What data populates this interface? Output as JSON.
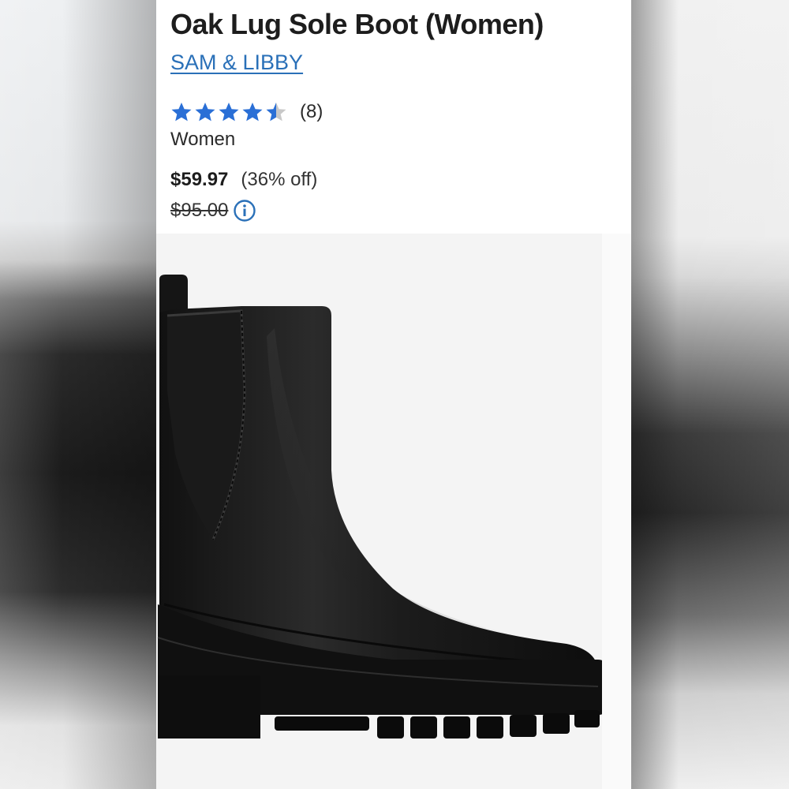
{
  "product": {
    "title": "Oak Lug Sole Boot (Women)",
    "brand": "SAM & LIBBY",
    "rating": {
      "value": 4.5,
      "max": 5,
      "review_count_label": "(8)"
    },
    "audience": "Women",
    "price": {
      "sale": "$59.97",
      "discount": "(36% off)",
      "original": "$95.00"
    },
    "image": {
      "subject": "black chelsea lug sole boot"
    }
  },
  "colors": {
    "star": "#2a6fd6",
    "star_empty": "#c8c8c8",
    "link": "#2a70b8",
    "info": "#2a70b8"
  },
  "icons": {
    "rating": "star-icon",
    "price_info": "info-icon"
  }
}
